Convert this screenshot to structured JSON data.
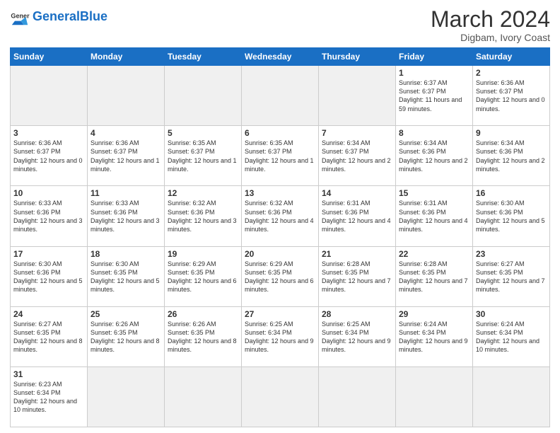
{
  "header": {
    "logo_general": "General",
    "logo_blue": "Blue",
    "title": "March 2024",
    "subtitle": "Digbam, Ivory Coast"
  },
  "days_of_week": [
    "Sunday",
    "Monday",
    "Tuesday",
    "Wednesday",
    "Thursday",
    "Friday",
    "Saturday"
  ],
  "weeks": [
    [
      {
        "day": "",
        "empty": true
      },
      {
        "day": "",
        "empty": true
      },
      {
        "day": "",
        "empty": true
      },
      {
        "day": "",
        "empty": true
      },
      {
        "day": "",
        "empty": true
      },
      {
        "day": "1",
        "sunrise": "6:37 AM",
        "sunset": "6:37 PM",
        "daylight": "11 hours and 59 minutes."
      },
      {
        "day": "2",
        "sunrise": "6:36 AM",
        "sunset": "6:37 PM",
        "daylight": "12 hours and 0 minutes."
      }
    ],
    [
      {
        "day": "3",
        "sunrise": "6:36 AM",
        "sunset": "6:37 PM",
        "daylight": "12 hours and 0 minutes."
      },
      {
        "day": "4",
        "sunrise": "6:36 AM",
        "sunset": "6:37 PM",
        "daylight": "12 hours and 1 minute."
      },
      {
        "day": "5",
        "sunrise": "6:35 AM",
        "sunset": "6:37 PM",
        "daylight": "12 hours and 1 minute."
      },
      {
        "day": "6",
        "sunrise": "6:35 AM",
        "sunset": "6:37 PM",
        "daylight": "12 hours and 1 minute."
      },
      {
        "day": "7",
        "sunrise": "6:34 AM",
        "sunset": "6:37 PM",
        "daylight": "12 hours and 2 minutes."
      },
      {
        "day": "8",
        "sunrise": "6:34 AM",
        "sunset": "6:36 PM",
        "daylight": "12 hours and 2 minutes."
      },
      {
        "day": "9",
        "sunrise": "6:34 AM",
        "sunset": "6:36 PM",
        "daylight": "12 hours and 2 minutes."
      }
    ],
    [
      {
        "day": "10",
        "sunrise": "6:33 AM",
        "sunset": "6:36 PM",
        "daylight": "12 hours and 3 minutes."
      },
      {
        "day": "11",
        "sunrise": "6:33 AM",
        "sunset": "6:36 PM",
        "daylight": "12 hours and 3 minutes."
      },
      {
        "day": "12",
        "sunrise": "6:32 AM",
        "sunset": "6:36 PM",
        "daylight": "12 hours and 3 minutes."
      },
      {
        "day": "13",
        "sunrise": "6:32 AM",
        "sunset": "6:36 PM",
        "daylight": "12 hours and 4 minutes."
      },
      {
        "day": "14",
        "sunrise": "6:31 AM",
        "sunset": "6:36 PM",
        "daylight": "12 hours and 4 minutes."
      },
      {
        "day": "15",
        "sunrise": "6:31 AM",
        "sunset": "6:36 PM",
        "daylight": "12 hours and 4 minutes."
      },
      {
        "day": "16",
        "sunrise": "6:30 AM",
        "sunset": "6:36 PM",
        "daylight": "12 hours and 5 minutes."
      }
    ],
    [
      {
        "day": "17",
        "sunrise": "6:30 AM",
        "sunset": "6:36 PM",
        "daylight": "12 hours and 5 minutes."
      },
      {
        "day": "18",
        "sunrise": "6:30 AM",
        "sunset": "6:35 PM",
        "daylight": "12 hours and 5 minutes."
      },
      {
        "day": "19",
        "sunrise": "6:29 AM",
        "sunset": "6:35 PM",
        "daylight": "12 hours and 6 minutes."
      },
      {
        "day": "20",
        "sunrise": "6:29 AM",
        "sunset": "6:35 PM",
        "daylight": "12 hours and 6 minutes."
      },
      {
        "day": "21",
        "sunrise": "6:28 AM",
        "sunset": "6:35 PM",
        "daylight": "12 hours and 7 minutes."
      },
      {
        "day": "22",
        "sunrise": "6:28 AM",
        "sunset": "6:35 PM",
        "daylight": "12 hours and 7 minutes."
      },
      {
        "day": "23",
        "sunrise": "6:27 AM",
        "sunset": "6:35 PM",
        "daylight": "12 hours and 7 minutes."
      }
    ],
    [
      {
        "day": "24",
        "sunrise": "6:27 AM",
        "sunset": "6:35 PM",
        "daylight": "12 hours and 8 minutes."
      },
      {
        "day": "25",
        "sunrise": "6:26 AM",
        "sunset": "6:35 PM",
        "daylight": "12 hours and 8 minutes."
      },
      {
        "day": "26",
        "sunrise": "6:26 AM",
        "sunset": "6:35 PM",
        "daylight": "12 hours and 8 minutes."
      },
      {
        "day": "27",
        "sunrise": "6:25 AM",
        "sunset": "6:34 PM",
        "daylight": "12 hours and 9 minutes."
      },
      {
        "day": "28",
        "sunrise": "6:25 AM",
        "sunset": "6:34 PM",
        "daylight": "12 hours and 9 minutes."
      },
      {
        "day": "29",
        "sunrise": "6:24 AM",
        "sunset": "6:34 PM",
        "daylight": "12 hours and 9 minutes."
      },
      {
        "day": "30",
        "sunrise": "6:24 AM",
        "sunset": "6:34 PM",
        "daylight": "12 hours and 10 minutes."
      }
    ],
    [
      {
        "day": "31",
        "sunrise": "6:23 AM",
        "sunset": "6:34 PM",
        "daylight": "12 hours and 10 minutes."
      },
      {
        "day": "",
        "empty": true
      },
      {
        "day": "",
        "empty": true
      },
      {
        "day": "",
        "empty": true
      },
      {
        "day": "",
        "empty": true
      },
      {
        "day": "",
        "empty": true
      },
      {
        "day": "",
        "empty": true
      }
    ]
  ]
}
